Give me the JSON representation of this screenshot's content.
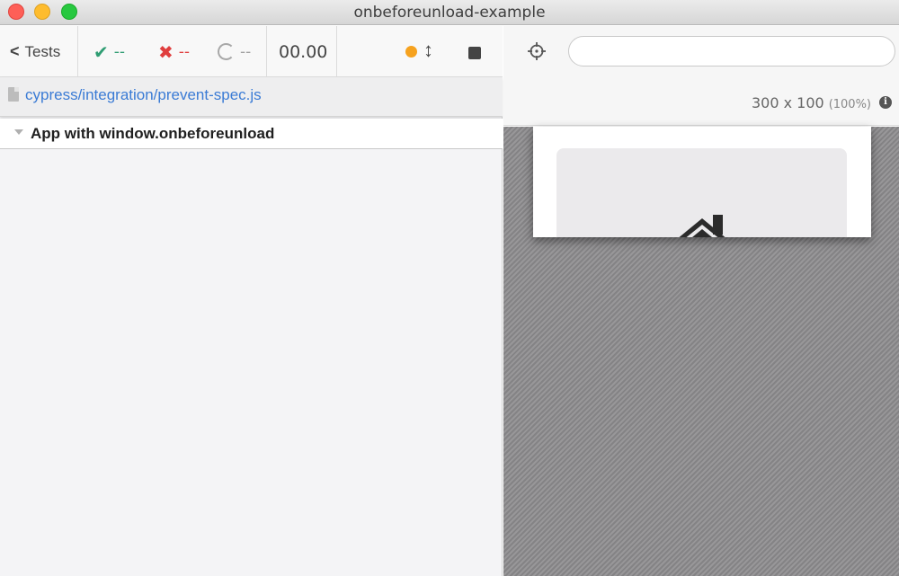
{
  "window": {
    "title": "onbeforeunload-example"
  },
  "toolbar": {
    "back_label": "Tests",
    "passed": "--",
    "failed": "--",
    "pending": "--",
    "duration": "00.00"
  },
  "spec": {
    "path": "cypress/integration/prevent-spec.js"
  },
  "suite": {
    "title": "App with window.onbeforeunload"
  },
  "aut": {
    "url_value": "",
    "viewport": "300 x 100",
    "scale": "(100%)"
  },
  "colors": {
    "passed": "#2f9d73",
    "failed": "#e03e3e",
    "running_dot": "#f6a21e",
    "link": "#3a7bd5"
  },
  "icons": [
    "chevron-left-icon",
    "check-icon",
    "x-icon",
    "spinner-icon",
    "running-dot-icon",
    "vertical-arrows-icon",
    "stop-icon",
    "file-icon",
    "caret-down-icon",
    "target-icon",
    "info-icon",
    "home-icon"
  ]
}
